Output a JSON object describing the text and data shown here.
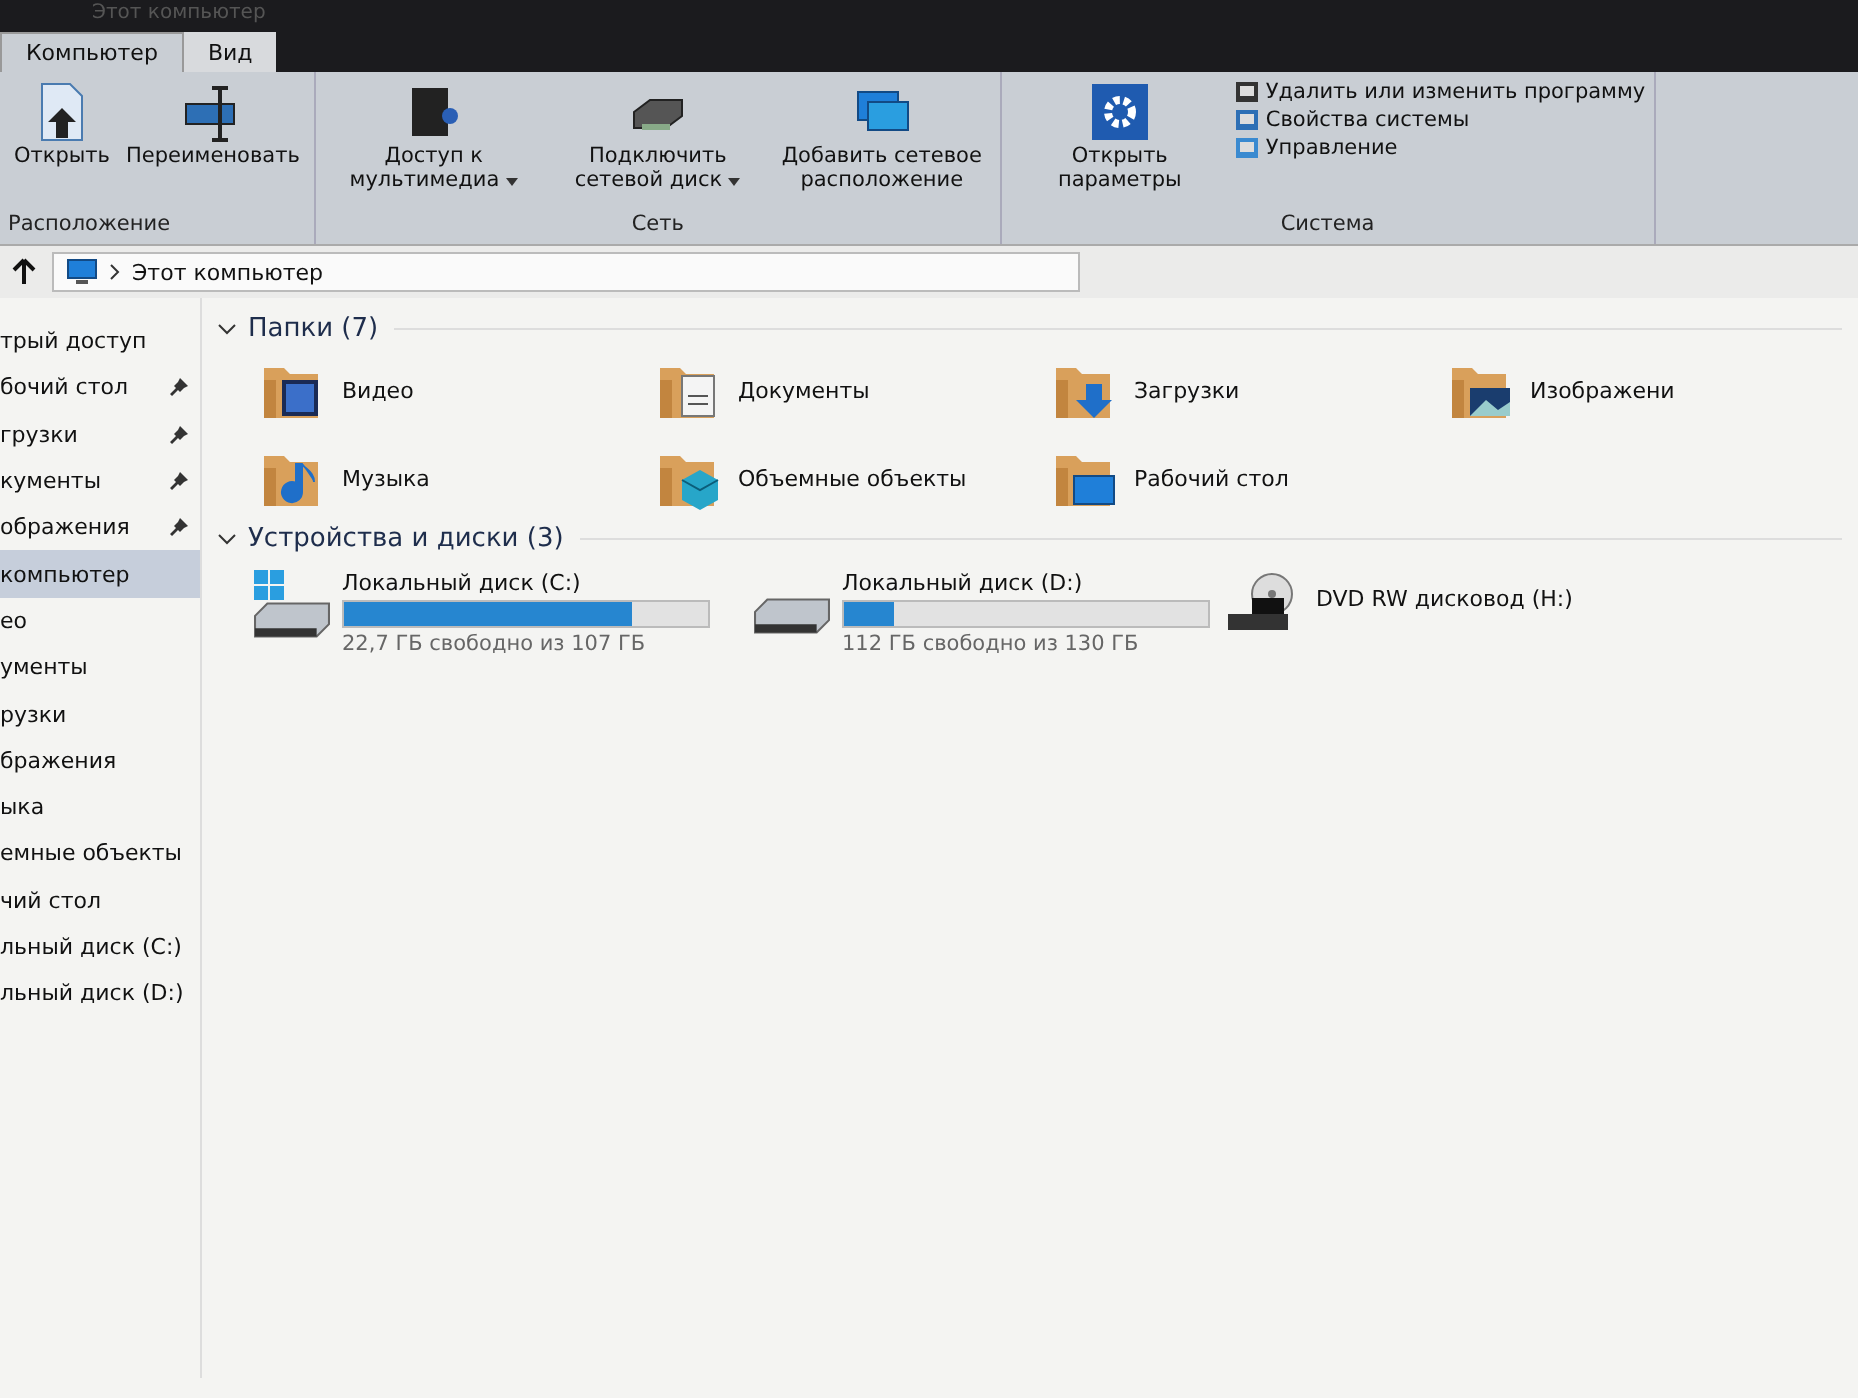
{
  "window": {
    "title": "Этот компьютер"
  },
  "tabs": [
    {
      "label": "Компьютер",
      "selected": true
    },
    {
      "label": "Вид",
      "selected": false
    }
  ],
  "ribbon": {
    "groups": [
      {
        "label": "Расположение",
        "buttons": [
          {
            "kind": "large",
            "label": "Открыть",
            "has_menu": false
          },
          {
            "kind": "large",
            "label": "Переименовать",
            "has_menu": false
          }
        ]
      },
      {
        "label": "Сеть",
        "buttons": [
          {
            "kind": "large",
            "label": "Доступ к мультимедиа",
            "has_menu": true
          },
          {
            "kind": "large",
            "label": "Подключить сетевой диск",
            "has_menu": true
          },
          {
            "kind": "large",
            "label": "Добавить сетевое расположение",
            "has_menu": false
          }
        ]
      },
      {
        "label": "Система",
        "buttons": [
          {
            "kind": "large",
            "label": "Открыть параметры",
            "has_menu": false
          },
          {
            "kind": "small",
            "label": "Удалить или изменить программу",
            "has_menu": false
          },
          {
            "kind": "small",
            "label": "Свойства системы",
            "has_menu": false
          },
          {
            "kind": "small",
            "label": "Управление",
            "has_menu": false
          }
        ]
      }
    ]
  },
  "address_bar": {
    "path": "Этот компьютер"
  },
  "sidebar": {
    "items": [
      {
        "label": "трый доступ",
        "pinned": false,
        "selected": false
      },
      {
        "label": "бочий стол",
        "pinned": true,
        "selected": false
      },
      {
        "label": "грузки",
        "pinned": true,
        "selected": false
      },
      {
        "label": "кументы",
        "pinned": true,
        "selected": false
      },
      {
        "label": "ображения",
        "pinned": true,
        "selected": false
      },
      {
        "label": "компьютер",
        "pinned": false,
        "selected": true
      },
      {
        "label": "ео",
        "pinned": false,
        "selected": false
      },
      {
        "label": "ументы",
        "pinned": false,
        "selected": false
      },
      {
        "label": "рузки",
        "pinned": false,
        "selected": false
      },
      {
        "label": "бражения",
        "pinned": false,
        "selected": false
      },
      {
        "label": "ыка",
        "pinned": false,
        "selected": false
      },
      {
        "label": "емные объекты",
        "pinned": false,
        "selected": false
      },
      {
        "label": "чий стол",
        "pinned": false,
        "selected": false
      },
      {
        "label": "льный диск (C:)",
        "pinned": false,
        "selected": false
      },
      {
        "label": "льный диск (D:)",
        "pinned": false,
        "selected": false
      }
    ]
  },
  "folders": {
    "title": "Папки (7)",
    "expanded": true,
    "items": [
      {
        "label": "Видео"
      },
      {
        "label": "Документы"
      },
      {
        "label": "Загрузки"
      },
      {
        "label": "Изображени"
      },
      {
        "label": "Музыка"
      },
      {
        "label": "Объемные объекты"
      },
      {
        "label": "Рабочий стол"
      }
    ]
  },
  "devices": {
    "title": "Устройства и диски (3)",
    "expanded": true,
    "items": [
      {
        "kind": "disk",
        "label": "Локальный диск (C:)",
        "level": 0.79,
        "reading": "22,7 ГБ свободно из 107 ГБ"
      },
      {
        "kind": "disk",
        "label": "Локальный диск (D:)",
        "level": 0.14,
        "reading": "112 ГБ свободно из 130 ГБ"
      },
      {
        "kind": "dvd",
        "label": "DVD RW дисковод (H:)"
      }
    ]
  }
}
